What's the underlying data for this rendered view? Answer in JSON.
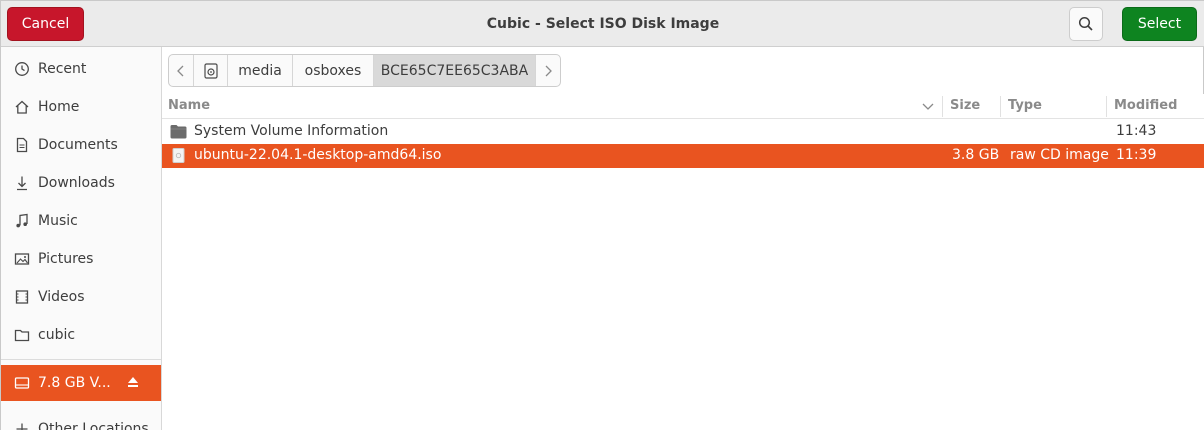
{
  "header": {
    "title": "Cubic - Select ISO Disk Image",
    "cancel_label": "Cancel",
    "select_label": "Select",
    "search_icon": "search-icon"
  },
  "sidebar": {
    "items": [
      {
        "label": "Recent",
        "icon": "clock-icon"
      },
      {
        "label": "Home",
        "icon": "home-icon"
      },
      {
        "label": "Documents",
        "icon": "document-icon"
      },
      {
        "label": "Downloads",
        "icon": "download-icon"
      },
      {
        "label": "Music",
        "icon": "music-icon"
      },
      {
        "label": "Pictures",
        "icon": "picture-icon"
      },
      {
        "label": "Videos",
        "icon": "video-icon"
      },
      {
        "label": "cubic",
        "icon": "folder-icon"
      }
    ],
    "volume": {
      "label": "7.8 GB V...",
      "icon": "drive-icon",
      "eject_icon": "eject-icon"
    },
    "other": {
      "label": "Other Locations",
      "icon": "plus-icon"
    }
  },
  "pathbar": {
    "crumbs": [
      "media",
      "osboxes",
      "BCE65C7EE65C3ABA"
    ],
    "current": "BCE65C7EE65C3ABA"
  },
  "filelist": {
    "columns": {
      "name": "Name",
      "size": "Size",
      "type": "Type",
      "modified": "Modified"
    },
    "rows": [
      {
        "name": "System Volume Information",
        "size": "",
        "type": "",
        "modified": "11:43",
        "icon": "folder-icon",
        "selected": false
      },
      {
        "name": "ubuntu-22.04.1-desktop-amd64.iso",
        "size": "3.8 GB",
        "type": "raw CD image",
        "modified": "11:39",
        "icon": "file-icon",
        "selected": true
      }
    ]
  },
  "colors": {
    "accent": "#e95420",
    "cancel": "#c7162b",
    "select": "#0e8420"
  }
}
